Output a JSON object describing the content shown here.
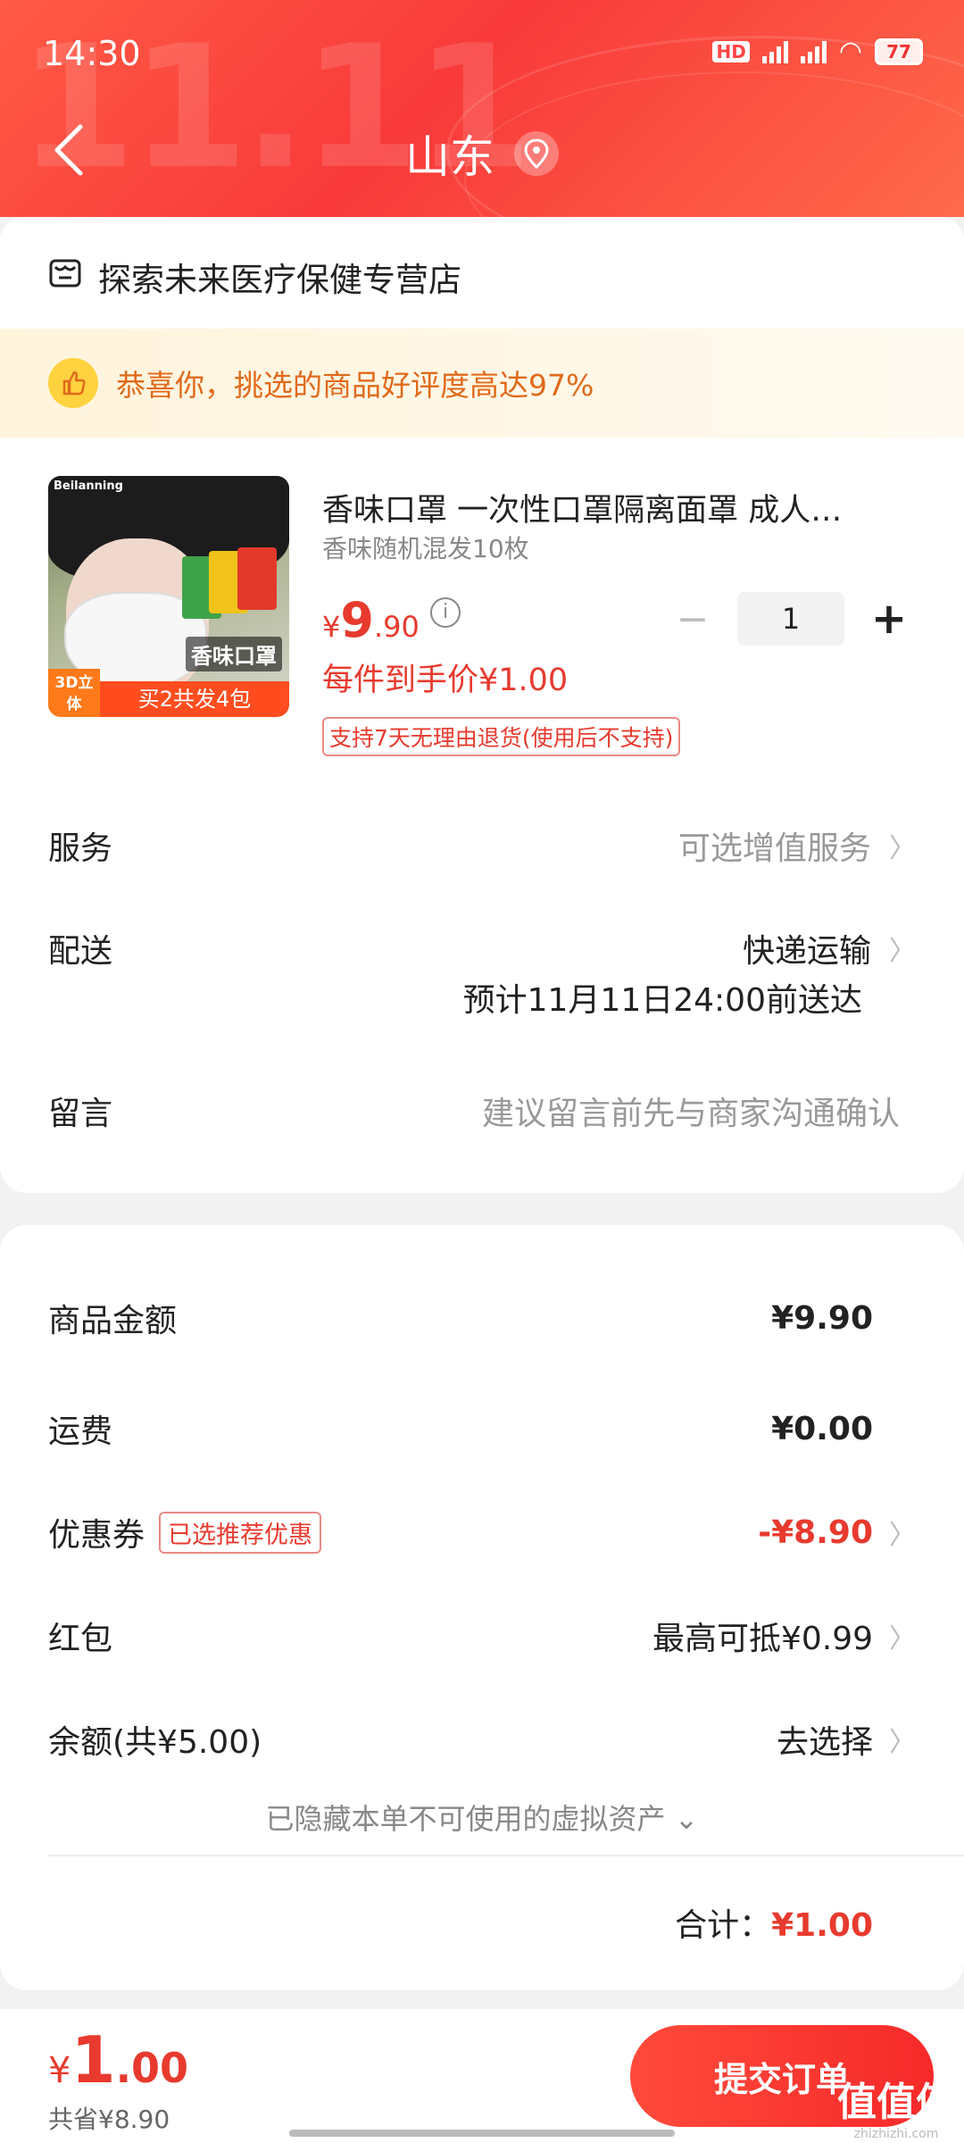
{
  "status_bar": {
    "time": "14:30",
    "network_label": "HD",
    "battery": "77"
  },
  "header": {
    "region": "山东",
    "bg_logo": "11.11"
  },
  "shop": {
    "name": "探索未来医疗保健专营店"
  },
  "banner": {
    "text": "恭喜你，挑选的商品好评度高达97%"
  },
  "product": {
    "image_brand": "Beilanning",
    "image_name": "香味口罩",
    "image_tag_3d": "3D立体",
    "image_tag_buy": "买2共发4包",
    "title": "香味口罩 一次性口罩隔离面罩 成人…",
    "spec": "香味随机混发10枚",
    "price_currency": "¥",
    "price_int": "9",
    "price_dec": ".90",
    "quantity": "1",
    "unit_price": "每件到手价¥1.00",
    "return_policy": "支持7天无理由退货(使用后不支持)"
  },
  "rows": {
    "service_label": "服务",
    "service_value": "可选增值服务",
    "delivery_label": "配送",
    "delivery_value": "快递运输",
    "delivery_eta": "预计11月11日24:00前送达",
    "message_label": "留言",
    "message_placeholder": "建议留言前先与商家沟通确认"
  },
  "fees": {
    "goods_label": "商品金额",
    "goods_value": "¥9.90",
    "shipping_label": "运费",
    "shipping_value": "¥0.00",
    "coupon_label": "优惠券",
    "coupon_tag": "已选推荐优惠",
    "coupon_value": "-¥8.90",
    "redpacket_label": "红包",
    "redpacket_value": "最高可抵¥0.99",
    "balance_label": "余额(共¥5.00)",
    "balance_value": "去选择",
    "hidden_note": "已隐藏本单不可使用的虚拟资产 ⌄",
    "total_label": "合计：",
    "total_value": "¥1.00"
  },
  "bottom": {
    "pay_currency": "¥",
    "pay_int": "1",
    "pay_dec": ".00",
    "saved": "共省¥8.90",
    "submit_label": "提交订单"
  },
  "watermark": {
    "big": "值值值",
    "small": "zhizhizhi.com"
  },
  "colors": {
    "primary_red": "#e83a2e",
    "header_red": "#f83a3a",
    "banner_orange": "#e06a1a"
  }
}
